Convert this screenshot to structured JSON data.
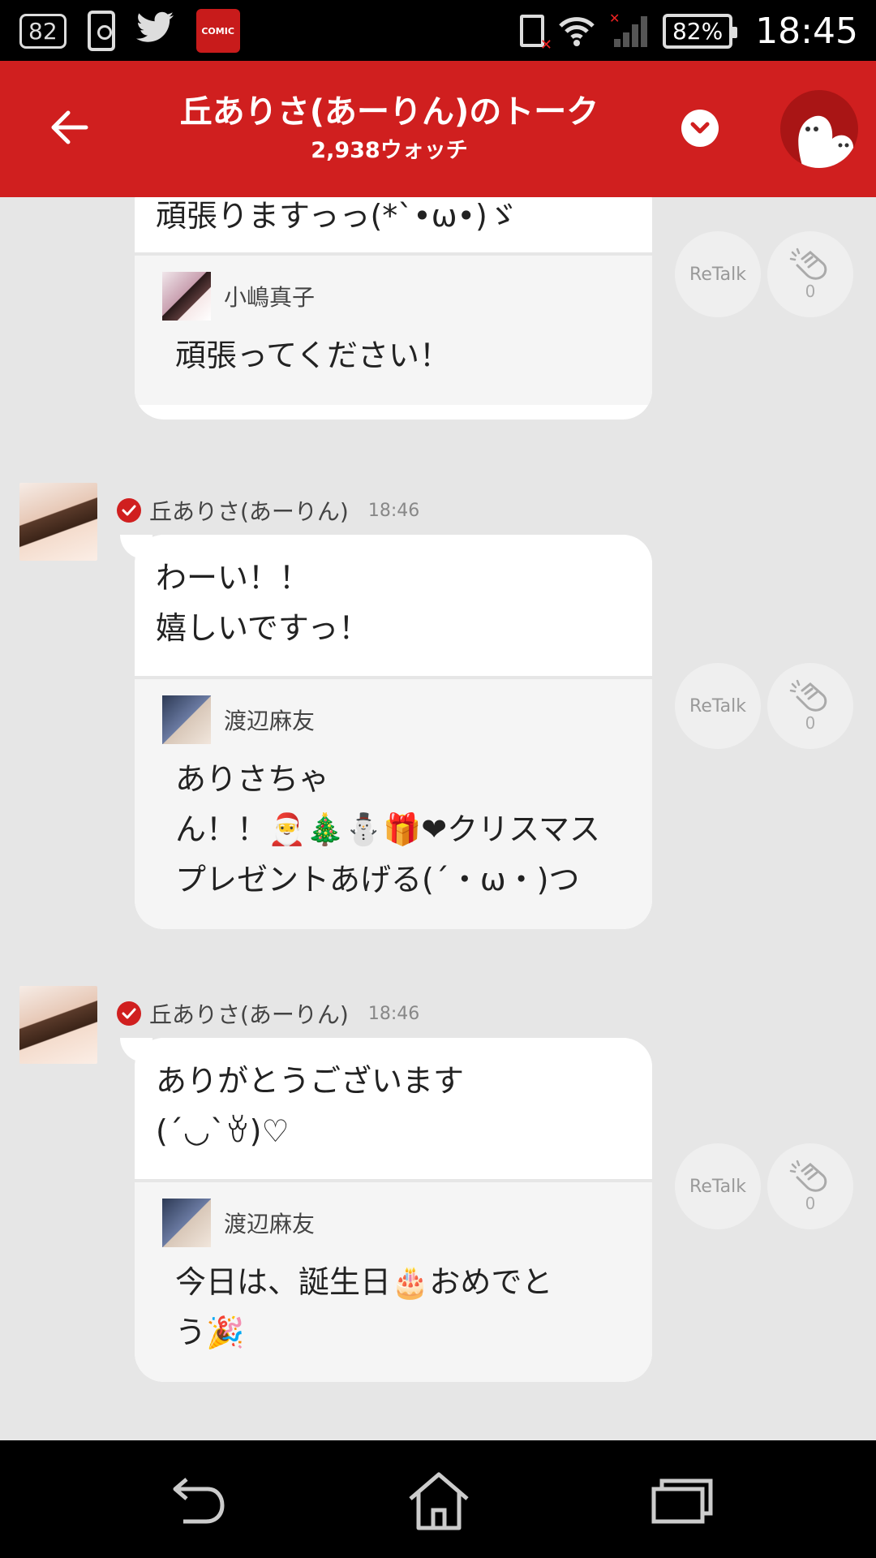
{
  "status_bar": {
    "notification_count": "82",
    "battery_level": "82%",
    "time": "18:45",
    "comic_label": "COMIC"
  },
  "header": {
    "title": "丘ありさ(あーりん)のトーク",
    "watch_count": "2,938ウォッチ"
  },
  "messages": [
    {
      "text": "頑張りますっっ(*`•ω•)ゞ",
      "reply": {
        "name": "小嶋真子",
        "text": "頑張ってください！"
      },
      "retalk_label": "ReTalk",
      "clap_count": "0"
    },
    {
      "sender": "丘ありさ(あーりん)",
      "time": "18:46",
      "text_lines": [
        "わーい！！",
        "嬉しいですっ！"
      ],
      "reply": {
        "name": "渡辺麻友",
        "text_lines": [
          "ありさちゃ",
          "ん！！🎅🎄⛄🎁❤クリスマス",
          "プレゼントあげる(´・ω・)つ"
        ]
      },
      "retalk_label": "ReTalk",
      "clap_count": "0"
    },
    {
      "sender": "丘ありさ(あーりん)",
      "time": "18:46",
      "text_lines": [
        "ありがとうございます",
        "(´◡`ꈊ)♡"
      ],
      "reply": {
        "name": "渡辺麻友",
        "text_lines": [
          "今日は、誕生日🎂おめでと",
          "う🎉"
        ]
      },
      "retalk_label": "ReTalk",
      "clap_count": "0"
    }
  ],
  "colors": {
    "header_red": "#d01f1f",
    "background": "#e6e6e6",
    "bubble": "#ffffff",
    "reply_bg": "#f5f5f5"
  },
  "icons": [
    "back-arrow-icon",
    "chevron-down-icon",
    "mascot-icon",
    "verified-check-icon",
    "clap-icon",
    "nav-back-icon",
    "nav-home-icon",
    "nav-recents-icon"
  ]
}
